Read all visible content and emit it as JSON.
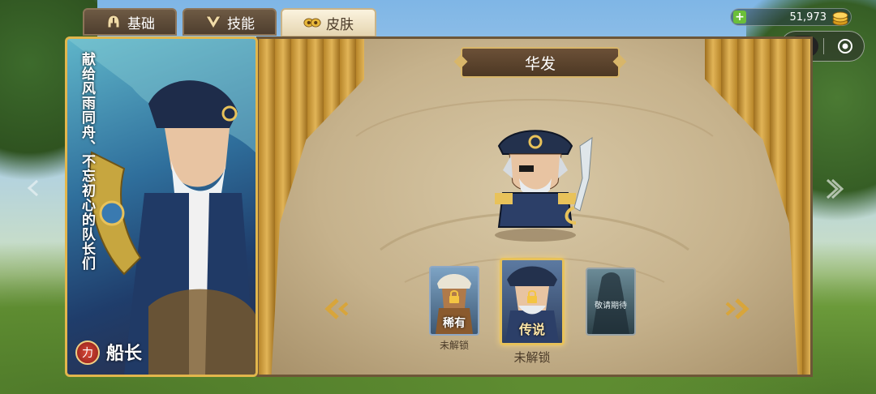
{
  "tabs": [
    {
      "label": "基础",
      "icon": "helmet-icon"
    },
    {
      "label": "技能",
      "icon": "skill-crest-icon"
    },
    {
      "label": "皮肤",
      "icon": "skin-mask-icon"
    }
  ],
  "active_tab": "皮肤",
  "currency": {
    "amount": "51,973",
    "icon": "gold-coins-icon"
  },
  "skin": {
    "current_name": "华发"
  },
  "hero": {
    "dedication": "献给风雨同舟、不忘初心的队长们",
    "class": "力",
    "name": "船长"
  },
  "skins": [
    {
      "rarity": "稀有",
      "status": "未解锁"
    },
    {
      "rarity": "传说",
      "status": "未解锁"
    },
    {
      "rarity": "",
      "status": "",
      "placeholder": "敬请期待"
    }
  ],
  "colors": {
    "gold_border": "#e2b64c",
    "panel_bg": "#c6b28c",
    "banner": "#5a4430"
  }
}
